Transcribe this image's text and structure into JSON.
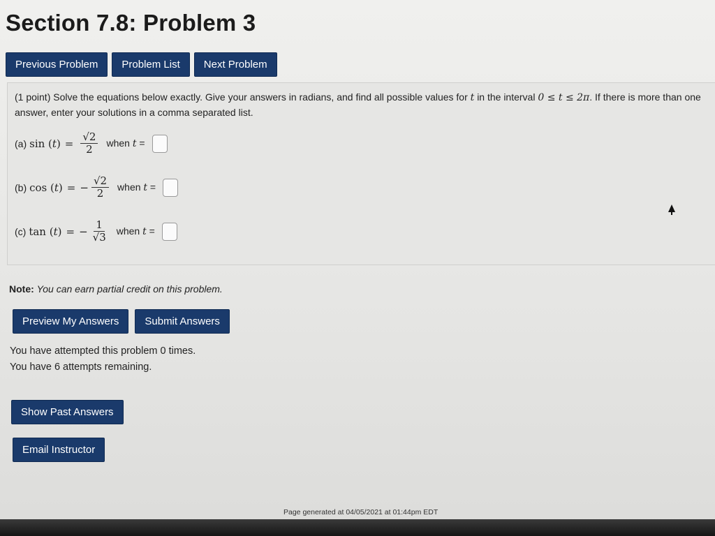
{
  "page": {
    "title": "Section 7.8: Problem 3"
  },
  "nav": {
    "previous_label": "Previous Problem",
    "list_label": "Problem List",
    "next_label": "Next Problem"
  },
  "problem": {
    "points": "(1 point)",
    "instructions_a": "Solve the equations below exactly. Give your answers in radians, and find all possible values for",
    "var": "t",
    "instructions_b": "in the interval",
    "interval": "0 ≤ t ≤ 2π",
    "instructions_c": ". If there is more than one answer, enter your solutions in a comma separated list.",
    "parts": [
      {
        "label": "(a)",
        "func": "sin",
        "arg": "t",
        "sign": "",
        "numerator": "√2",
        "denominator": "2",
        "when": "when",
        "answer": ""
      },
      {
        "label": "(b)",
        "func": "cos",
        "arg": "t",
        "sign": "−",
        "numerator": "√2",
        "denominator": "2",
        "when": "when",
        "answer": ""
      },
      {
        "label": "(c)",
        "func": "tan",
        "arg": "t",
        "sign": "−",
        "numerator": "1",
        "denominator": "√3",
        "when": "when",
        "answer": ""
      }
    ]
  },
  "note": {
    "label": "Note:",
    "text": "You can earn partial credit on this problem."
  },
  "actions": {
    "preview_label": "Preview My Answers",
    "submit_label": "Submit Answers",
    "show_past_label": "Show Past Answers",
    "email_label": "Email Instructor"
  },
  "attempts": {
    "line1": "You have attempted this problem 0 times.",
    "line2": "You have 6 attempts remaining."
  },
  "footer": {
    "text": "Page generated at 04/05/2021 at 01:44pm EDT"
  },
  "colors": {
    "button_bg": "#1a3a6b",
    "page_bg": "#e9e9e7"
  }
}
